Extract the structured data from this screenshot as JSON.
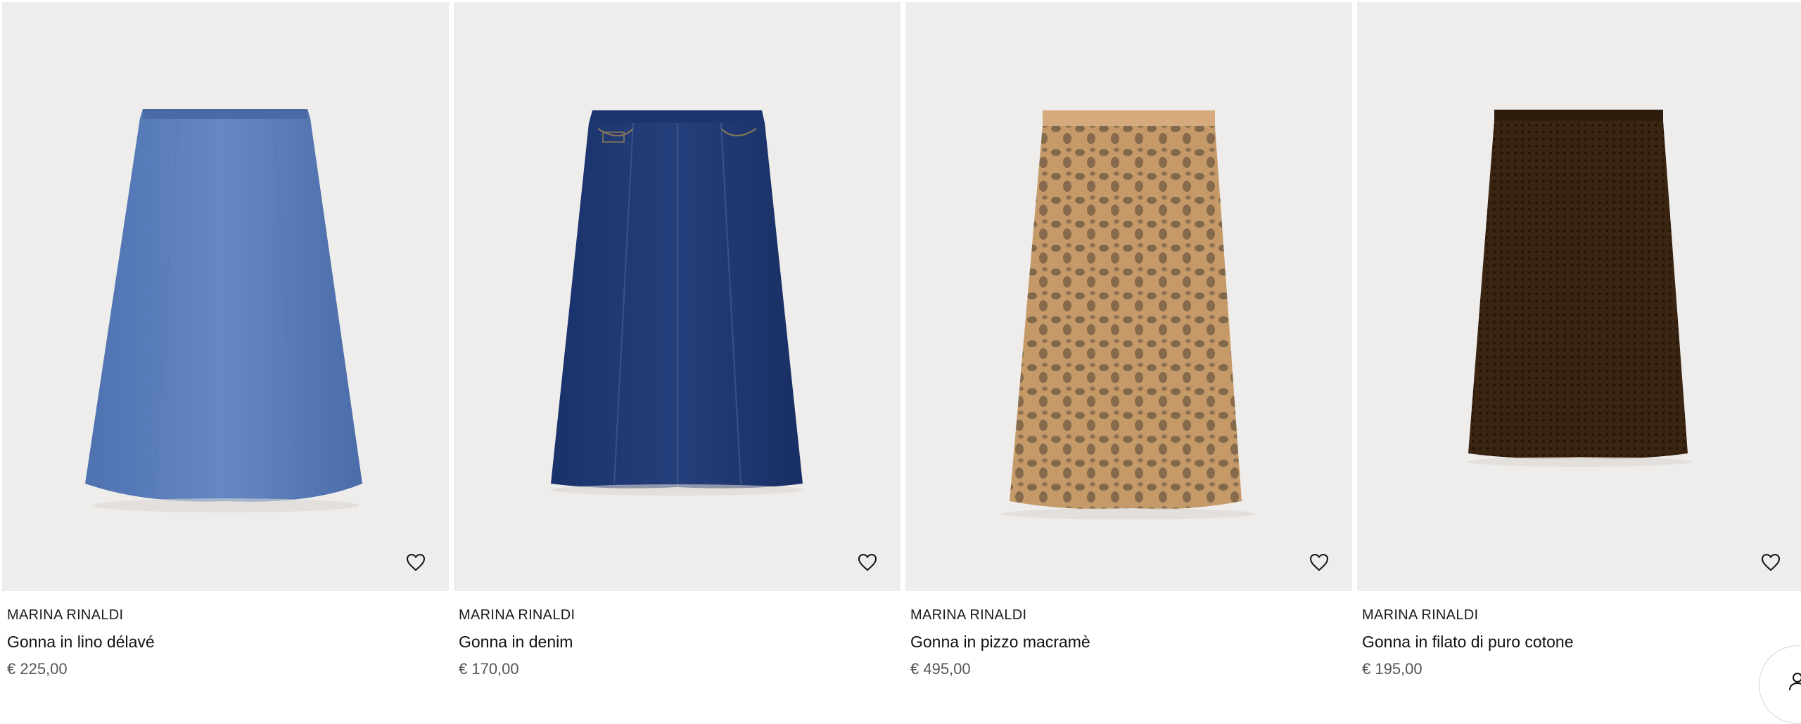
{
  "products": [
    {
      "brand": "MARINA RINALDI",
      "name": "Gonna in lino délavé",
      "price": "€ 225,00",
      "color": "#5b7db8"
    },
    {
      "brand": "MARINA RINALDI",
      "name": "Gonna in denim",
      "price": "€ 170,00",
      "color": "#203a70"
    },
    {
      "brand": "MARINA RINALDI",
      "name": "Gonna in pizzo macramè",
      "price": "€ 495,00",
      "color": "#c9a171"
    },
    {
      "brand": "MARINA RINALDI",
      "name": "Gonna in filato di puro cotone",
      "price": "€ 195,00",
      "color": "#3b2614"
    }
  ],
  "icons": {
    "wishlist": "heart-icon",
    "corner": "user-icon"
  },
  "colors": {
    "image_background": "#efedeb"
  }
}
